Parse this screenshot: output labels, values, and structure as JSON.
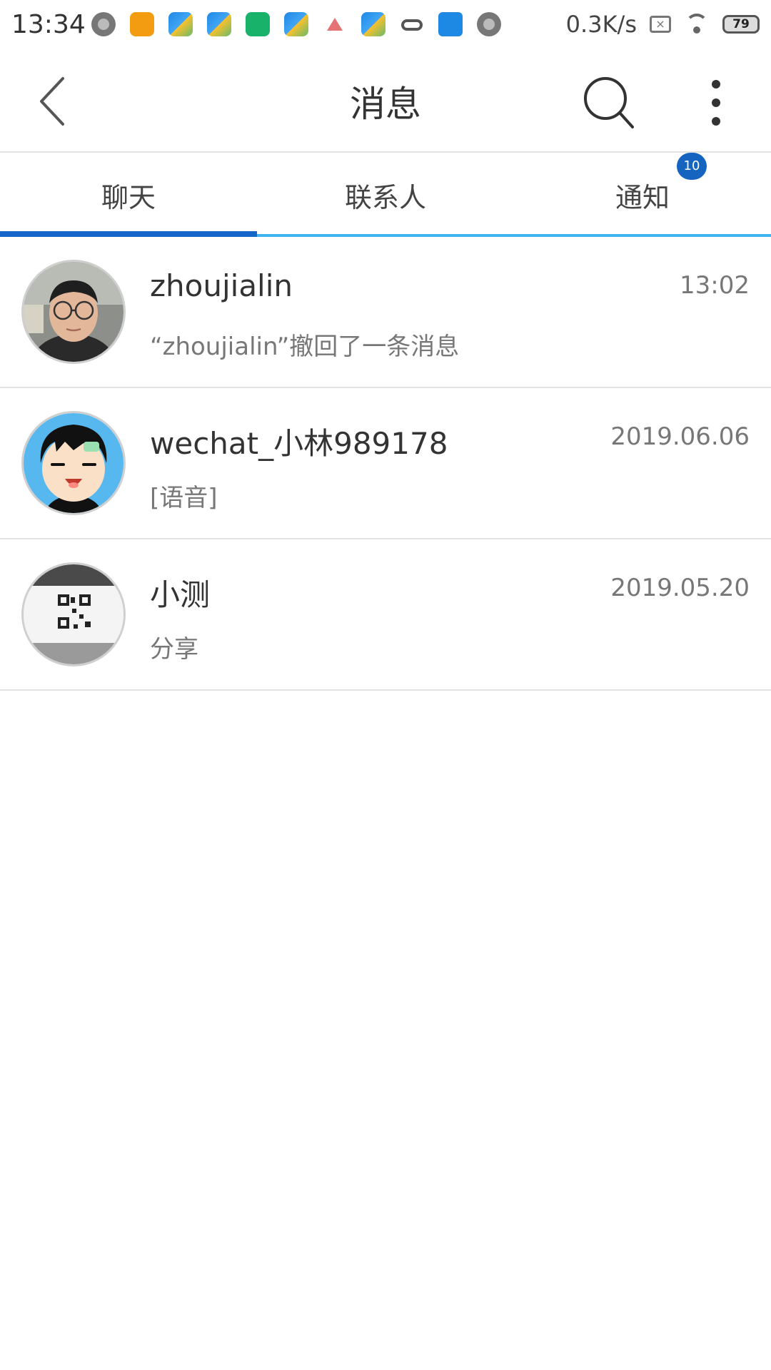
{
  "status_bar": {
    "time": "13:34",
    "net_speed": "0.3K/s",
    "battery": "79",
    "notification_icons": [
      "gray-circle-icon",
      "taobao-icon",
      "plane-app-icon",
      "plane-app-icon",
      "green-app-icon",
      "plane-app-icon",
      "triangle-app-icon",
      "plane-app-icon",
      "cloud-icon",
      "blue-app-icon",
      "gray-circle-icon"
    ]
  },
  "header": {
    "title": "消息"
  },
  "tabs": [
    {
      "label": "聊天",
      "active": true
    },
    {
      "label": "联系人",
      "active": false
    },
    {
      "label": "通知",
      "active": false,
      "badge": "10"
    }
  ],
  "colors": {
    "accent": "#1566c8",
    "tab_line": "#3fb3ee",
    "badge": "#1565c0"
  },
  "chats": [
    {
      "name": "zhoujialin",
      "time": "13:02",
      "message": "“zhoujialin”撤回了一条消息",
      "avatar": "photo-avatar"
    },
    {
      "name": "wechat_小林989178",
      "time": "2019.06.06",
      "message": "[语音]",
      "avatar": "cartoon-avatar"
    },
    {
      "name": "小测",
      "time": "2019.05.20",
      "message": "分享",
      "avatar": "qr-photo-avatar"
    }
  ]
}
